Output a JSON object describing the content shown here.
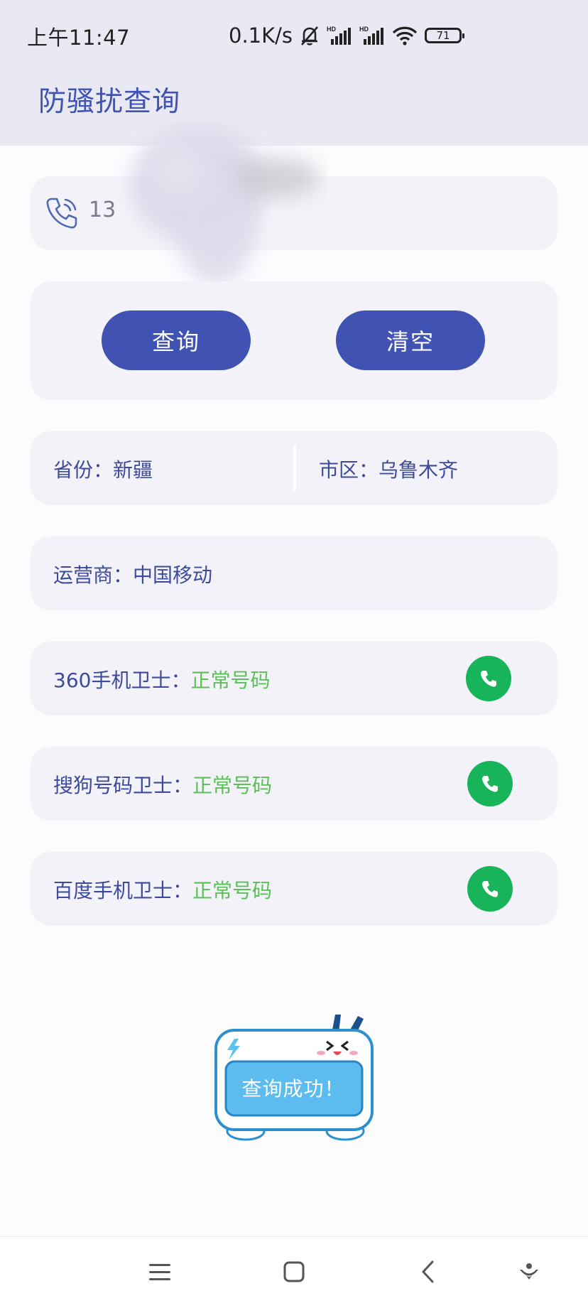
{
  "status_bar": {
    "time": "上午11:47",
    "net_speed": "0.1K/s",
    "battery": "71",
    "icons": [
      "bell-off-icon",
      "hd-signal-icon",
      "hd-signal-icon",
      "wifi-icon",
      "battery-icon"
    ]
  },
  "header": {
    "title": "防骚扰查询"
  },
  "phone_input": {
    "value": "13",
    "icon": "phone-icon"
  },
  "buttons": {
    "query": "查询",
    "clear": "清空"
  },
  "location": {
    "province_label": "省份：",
    "province": "新疆",
    "city_label": "市区：",
    "city": "乌鲁木齐"
  },
  "carrier": {
    "label": "运营商：",
    "value": "中国移动"
  },
  "guards": [
    {
      "label": "360手机卫士：",
      "status": "正常号码"
    },
    {
      "label": "搜狗号码卫士：",
      "status": "正常号码"
    },
    {
      "label": "百度手机卫士：",
      "status": "正常号码"
    }
  ],
  "toast": {
    "message": "查询成功！"
  },
  "nav": {
    "icons": [
      "menu-icon",
      "home-icon",
      "back-icon",
      "assistant-icon"
    ]
  },
  "colors": {
    "accent": "#4153b2",
    "card": "#f2f2f8",
    "ok_green": "#5cbf58",
    "call_green": "#18b45a"
  }
}
